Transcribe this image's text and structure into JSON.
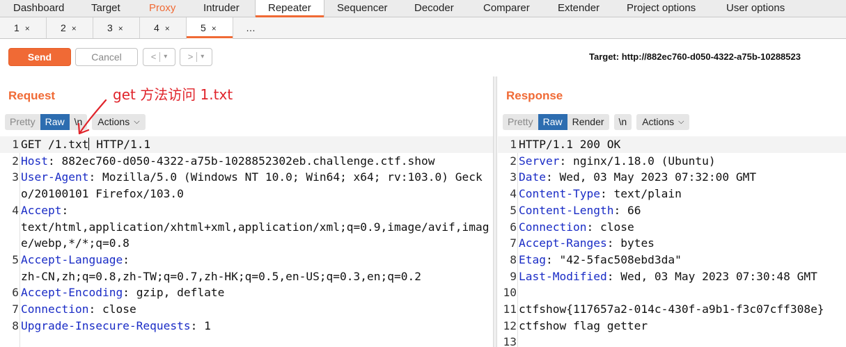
{
  "main_tabs": [
    {
      "label": "Dashboard"
    },
    {
      "label": "Target"
    },
    {
      "label": "Proxy"
    },
    {
      "label": "Intruder"
    },
    {
      "label": "Repeater"
    },
    {
      "label": "Sequencer"
    },
    {
      "label": "Decoder"
    },
    {
      "label": "Comparer"
    },
    {
      "label": "Extender"
    },
    {
      "label": "Project options"
    },
    {
      "label": "User options"
    }
  ],
  "active_main_tab": "Repeater",
  "highlighted_main_tab": "Proxy",
  "sub_tabs": [
    {
      "label": "1",
      "close": "×"
    },
    {
      "label": "2",
      "close": "×"
    },
    {
      "label": "3",
      "close": "×"
    },
    {
      "label": "4",
      "close": "×"
    },
    {
      "label": "5",
      "close": "×"
    },
    {
      "label": "…"
    }
  ],
  "active_sub_tab": "5",
  "toolbar": {
    "send_label": "Send",
    "cancel_label": "Cancel",
    "prev_label": "<",
    "next_label": ">",
    "dropdown_glyph": "▾",
    "target_text": "Target: http://882ec760-d050-4322-a75b-10288523"
  },
  "request": {
    "title": "Request",
    "views": [
      "Pretty",
      "Raw",
      "\\n"
    ],
    "active_view": "Raw",
    "actions_label": "Actions",
    "lines": [
      {
        "n": "1",
        "key": "",
        "sep": "",
        "value": "GET /1.txt",
        "after_caret": " HTTP/1.1"
      },
      {
        "n": "2",
        "key": "Host",
        "sep": ": ",
        "value": "882ec760-d050-4322-a75b-1028852302eb.challenge.ctf.show"
      },
      {
        "n": "3",
        "key": "User-Agent",
        "sep": ": ",
        "value": "Mozilla/5.0 (Windows NT 10.0; Win64; x64; rv:103.0) Gecko/20100101 Firefox/103.0"
      },
      {
        "n": "4",
        "key": "Accept",
        "sep": ":",
        "value": "\ntext/html,application/xhtml+xml,application/xml;q=0.9,image/avif,image/webp,*/*;q=0.8"
      },
      {
        "n": "5",
        "key": "Accept-Language",
        "sep": ":",
        "value": "\nzh-CN,zh;q=0.8,zh-TW;q=0.7,zh-HK;q=0.5,en-US;q=0.3,en;q=0.2"
      },
      {
        "n": "6",
        "key": "Accept-Encoding",
        "sep": ": ",
        "value": "gzip, deflate"
      },
      {
        "n": "7",
        "key": "Connection",
        "sep": ": ",
        "value": "close"
      },
      {
        "n": "8",
        "key": "Upgrade-Insecure-Requests",
        "sep": ": ",
        "value": "1"
      }
    ]
  },
  "response": {
    "title": "Response",
    "views": [
      "Pretty",
      "Raw",
      "Render",
      "\\n"
    ],
    "active_view": "Raw",
    "actions_label": "Actions",
    "lines": [
      {
        "n": "1",
        "key": "",
        "sep": "",
        "value": "HTTP/1.1 200 OK"
      },
      {
        "n": "2",
        "key": "Server",
        "sep": ": ",
        "value": "nginx/1.18.0 (Ubuntu)"
      },
      {
        "n": "3",
        "key": "Date",
        "sep": ": ",
        "value": "Wed, 03 May 2023 07:32:00 GMT"
      },
      {
        "n": "4",
        "key": "Content-Type",
        "sep": ": ",
        "value": "text/plain"
      },
      {
        "n": "5",
        "key": "Content-Length",
        "sep": ": ",
        "value": "66"
      },
      {
        "n": "6",
        "key": "Connection",
        "sep": ": ",
        "value": "close"
      },
      {
        "n": "7",
        "key": "Accept-Ranges",
        "sep": ": ",
        "value": "bytes"
      },
      {
        "n": "8",
        "key": "Etag",
        "sep": ": ",
        "value": "\"42-5fac508ebd3da\""
      },
      {
        "n": "9",
        "key": "Last-Modified",
        "sep": ": ",
        "value": "Wed, 03 May 2023 07:30:48 GMT"
      },
      {
        "n": "10",
        "key": "",
        "sep": "",
        "value": ""
      },
      {
        "n": "11",
        "key": "",
        "sep": "",
        "value": "ctfshow{117657a2-014c-430f-a9b1-f3c07cff308e}"
      },
      {
        "n": "12",
        "key": "",
        "sep": "",
        "value": "ctfshow flag getter"
      },
      {
        "n": "13",
        "key": "",
        "sep": "",
        "value": ""
      }
    ]
  },
  "annotation": {
    "text": "get 方法访问 1.txt",
    "color": "#e0242b"
  },
  "colors": {
    "accent": "#f06a35",
    "active_view": "#2d6db0",
    "header_key": "#1a2cc6"
  }
}
